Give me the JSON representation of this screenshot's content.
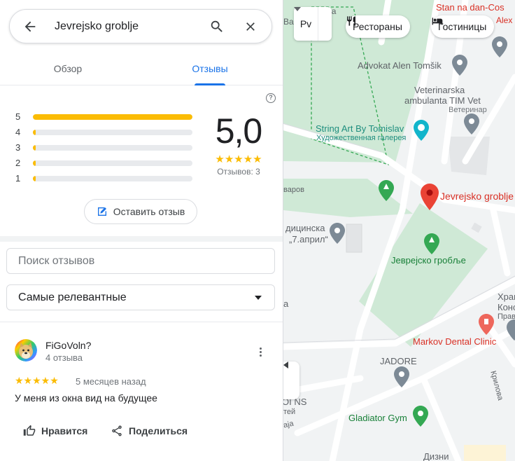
{
  "search": {
    "query": "Jevrejsko groblje",
    "back_icon": "arrow-back-icon",
    "search_icon": "search-icon",
    "close_icon": "close-icon"
  },
  "tabs": [
    {
      "label": "Обзор",
      "active": false
    },
    {
      "label": "Отзывы",
      "active": true
    }
  ],
  "rating": {
    "value": "5,0",
    "stars": "★★★★★",
    "count_text": "Отзывов: 3",
    "distribution": [
      {
        "stars": "5",
        "fraction": 1.0
      },
      {
        "stars": "4",
        "fraction": 0.0
      },
      {
        "stars": "3",
        "fraction": 0.0
      },
      {
        "stars": "2",
        "fraction": 0.0
      },
      {
        "stars": "1",
        "fraction": 0.0
      }
    ]
  },
  "write_review": {
    "label": "Оставить отзыв",
    "icon": "edit-review-icon"
  },
  "review_search": {
    "placeholder": "Поиск отзывов"
  },
  "sort": {
    "value": "Самые релевантные"
  },
  "reviews": [
    {
      "author": "FiGoVoln?",
      "author_reviews": "4 отзыва",
      "stars": "★★★★★",
      "date": "5 месяцев назад",
      "text": "У меня из окна вид на будущее",
      "like_label": "Нравится",
      "share_label": "Поделиться"
    }
  ],
  "map": {
    "layer_button": "Рv",
    "chips": [
      {
        "label": "Рестораны",
        "icon": "restaurant-icon"
      },
      {
        "label": "Гостиницы",
        "icon": "hotel-icon"
      }
    ],
    "labels": {
      "stan": "Stan na dan-Cos",
      "school_top": "кола",
      "school_left": "Вас",
      "advokat": "Advokat Alen Tomšik",
      "vet1": "Veterinarska",
      "vet2": "ambulanta TIM Vet",
      "vet3": "Ветеринар",
      "string_art": "String Art By Tomislav",
      "gallery": "Художественная галерея",
      "varov": "варов",
      "jevrejsko_pin": "Jevrejsko groblje",
      "medical1": "дицинска",
      "medical2": "„7.април“",
      "jevrejsko_cyr": "Јеврејско гробље",
      "hram1": "Храм",
      "hram2": "Конс",
      "hram3": "Прав",
      "markov": "Markov Dental Clinic",
      "jadore": "JADORE",
      "krilova": "Крилова",
      "ins": "OI NS",
      "gladiator": "Gladiator Gym",
      "dizni": "Дизни",
      "small_a": "а",
      "small_te": "тей",
      "small_ja": "аја",
      "alex": "Alex"
    }
  }
}
